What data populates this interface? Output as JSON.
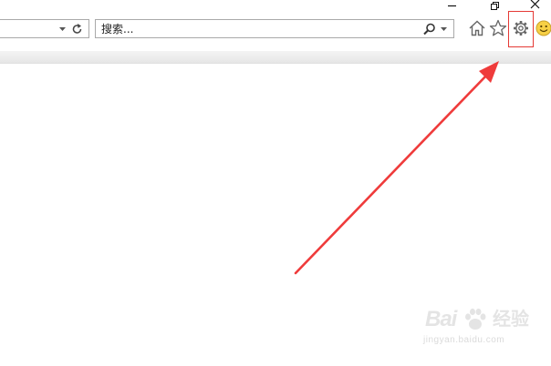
{
  "window_controls": {
    "minimize": "minimize-icon",
    "restore": "restore-icon",
    "close": "close-icon"
  },
  "address_bar": {
    "dropdown_icon": "chevron-down-icon",
    "refresh_icon": "refresh-icon"
  },
  "search": {
    "text": "搜索...",
    "icon": "search-icon",
    "dropdown_icon": "chevron-down-icon"
  },
  "toolbar_icons": [
    "home-icon",
    "star-icon",
    "gear-icon",
    "smiley-icon"
  ],
  "annotation": {
    "highlight_color": "#e53935",
    "arrow_color": "#ef3b3b"
  },
  "watermark": {
    "logo_text": "Bai",
    "brand_cn": "经验",
    "url": "jingyan.baidu.com"
  }
}
